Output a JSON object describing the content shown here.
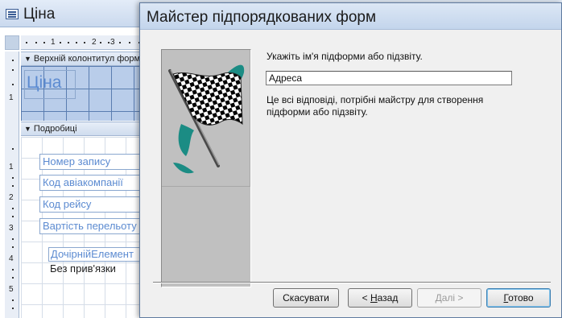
{
  "designer": {
    "title": "Ціна",
    "ruler_top_numbers": [
      "1",
      "2",
      "3"
    ],
    "ruler_left_numbers": [
      "1",
      "1",
      "2",
      "3",
      "4",
      "5"
    ],
    "header_section_label": "Верхній колонтитул форми",
    "header_title_label": "Ціна",
    "detail_section_label": "Подробиці",
    "fields": [
      "Номер запису",
      "Код авіакомпанії",
      "Код рейсу",
      "Вартість перельоту"
    ],
    "subform_control_label": "ДочірнійЕлемент",
    "unbound_text": "Без прив'язки"
  },
  "wizard": {
    "title": "Майстер підпорядкованих форм",
    "prompt": "Укажіть ім'я підформи або підзвіту.",
    "subform_name_value": "Адреса",
    "info": "Це всі відповіді, потрібні майстру для створення підформи або підзвіту.",
    "buttons": {
      "cancel": "Скасувати",
      "back_prefix": "< ",
      "back_hotkey": "Н",
      "back_rest": "азад",
      "next": "Далі >",
      "finish_hotkey": "Г",
      "finish_rest": "отово"
    },
    "icons": {
      "flag": "checkered-flag-icon"
    },
    "colors": {
      "accent_teal": "#1b8c84",
      "header_grid": "#b9cdea",
      "label_blue": "#5c8bd1"
    }
  }
}
